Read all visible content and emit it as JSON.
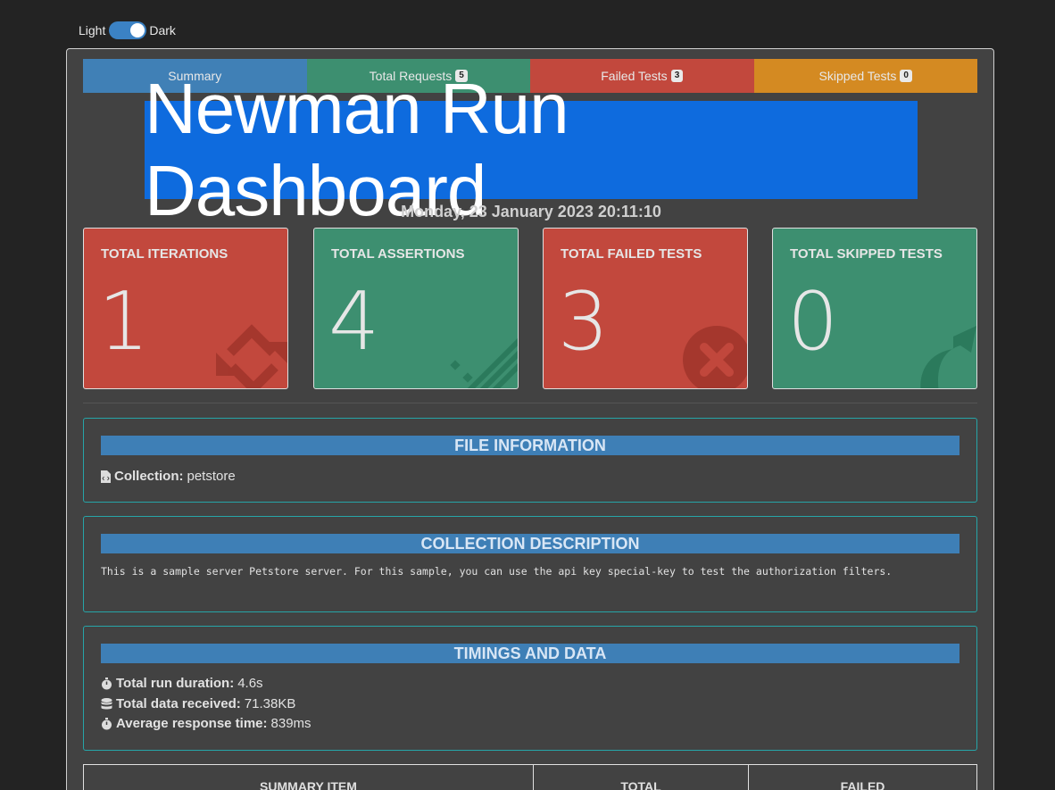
{
  "theme_toggle": {
    "light_label": "Light",
    "dark_label": "Dark"
  },
  "nav": {
    "tabs": [
      {
        "label": "Summary",
        "badge": null
      },
      {
        "label": "Total Requests",
        "badge": "5"
      },
      {
        "label": "Failed Tests",
        "badge": "3"
      },
      {
        "label": "Skipped Tests",
        "badge": "0"
      }
    ]
  },
  "title": "Newman Run Dashboard",
  "datetime": "Monday, 23 January 2023 20:11:10",
  "cards": [
    {
      "label": "TOTAL ITERATIONS",
      "value": "1",
      "icon": "sync-icon"
    },
    {
      "label": "TOTAL ASSERTIONS",
      "value": "4",
      "icon": "list-check-icon"
    },
    {
      "label": "TOTAL FAILED TESTS",
      "value": "3",
      "icon": "times-circle-icon"
    },
    {
      "label": "TOTAL SKIPPED TESTS",
      "value": "0",
      "icon": "share-arrow-icon"
    }
  ],
  "file_info": {
    "header": "FILE INFORMATION",
    "collection_label": "Collection:",
    "collection_value": "petstore"
  },
  "collection_description": {
    "header": "COLLECTION DESCRIPTION",
    "text": "This is a sample server Petstore server. For this sample, you can use the api key special-key to test the authorization filters."
  },
  "timings": {
    "header": "TIMINGS AND DATA",
    "duration_label": "Total run duration:",
    "duration_value": "4.6s",
    "data_label": "Total data received:",
    "data_value": "71.38KB",
    "avg_label": "Average response time:",
    "avg_value": "839ms"
  },
  "summary_table": {
    "headers": [
      "SUMMARY ITEM",
      "TOTAL",
      "FAILED"
    ]
  },
  "colors": {
    "summary": "#4080b6",
    "requests": "#3d8f70",
    "failed": "#c2483d",
    "skipped": "#d48a22",
    "title_bg": "#0e6bde"
  }
}
